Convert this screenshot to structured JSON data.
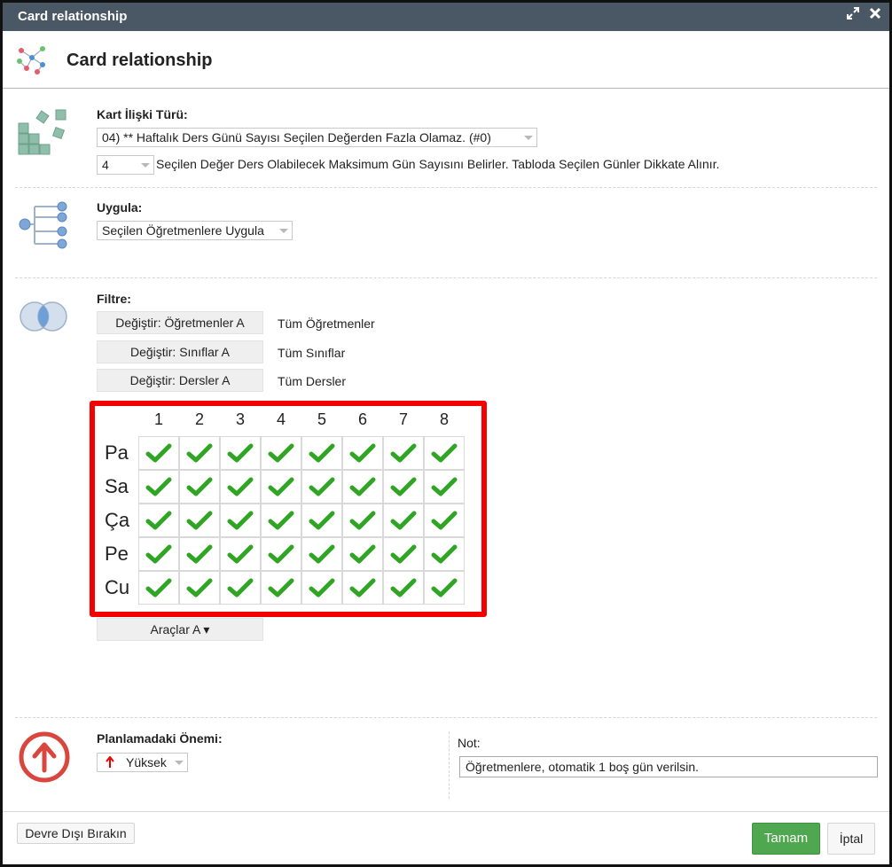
{
  "window": {
    "title": "Card relationship",
    "maximize_icon": "expand-icon",
    "close_icon": "close-icon"
  },
  "header": {
    "title": "Card relationship",
    "icon": "network-graph-icon"
  },
  "relation_type": {
    "label": "Kart İlişki Türü:",
    "selected": "04) ** Haftalık Ders Günü Sayısı Seçilen Değerden Fazla Olamaz. (#0)",
    "value": "4",
    "description": "Seçilen Değer Ders Olabilecek Maksimum Gün Sayısını Belirler. Tabloda Seçilen Günler Dikkate Alınır."
  },
  "apply": {
    "label": "Uygula:",
    "selected": "Seçilen Öğretmenlere Uygula"
  },
  "filter": {
    "label": "Filtre:",
    "rows": [
      {
        "button": "Değiştir: Öğretmenler A",
        "value": "Tüm Öğretmenler"
      },
      {
        "button": "Değiştir: Sınıflar A",
        "value": "Tüm Sınıflar"
      },
      {
        "button": "Değiştir: Dersler A",
        "value": "Tüm Dersler"
      }
    ]
  },
  "grid": {
    "columns": [
      "1",
      "2",
      "3",
      "4",
      "5",
      "6",
      "7",
      "8"
    ],
    "rows": [
      "Pa",
      "Sa",
      "Ça",
      "Pe",
      "Cu"
    ],
    "cell_icon": "checkmark-icon",
    "check_color": "#2fa523",
    "highlight_color": "#f30000"
  },
  "tools": {
    "label": "Araçlar A ▾"
  },
  "priority": {
    "label": "Planlamadaki Önemi:",
    "selected": "Yüksek",
    "icon": "arrow-up-icon",
    "color": "#d9463d"
  },
  "note": {
    "label": "Not:",
    "value": "Öğretmenlere, otomatik 1 boş gün verilsin."
  },
  "footer": {
    "disable_label": "Devre Dışı Bırakın",
    "ok_label": "Tamam",
    "cancel_label": "İptal"
  }
}
